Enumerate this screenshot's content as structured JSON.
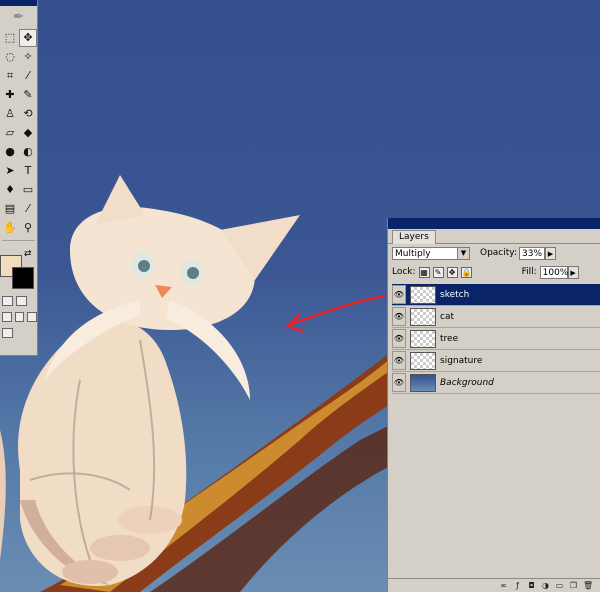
{
  "colors": {
    "canvas_top": "#34508f",
    "canvas_bottom": "#6a8db3",
    "panel_bg": "#d4d0c8",
    "selection_blue": "#0a246a",
    "annotation_red": "#e8202a",
    "foreground_swatch": "#f2dcc0",
    "background_swatch": "#000000"
  },
  "tools_panel": {
    "logo_icon": "feather-icon",
    "rows": [
      [
        "marquee-icon",
        "move-icon"
      ],
      [
        "lasso-icon",
        "magic-wand-icon"
      ],
      [
        "crop-icon",
        "slice-icon"
      ],
      [
        "healing-brush-icon",
        "brush-icon"
      ],
      [
        "clone-stamp-icon",
        "history-brush-icon"
      ],
      [
        "eraser-icon",
        "paint-bucket-icon"
      ],
      [
        "blur-icon",
        "dodge-icon"
      ],
      [
        "path-select-icon",
        "type-icon"
      ],
      [
        "pen-icon",
        "rectangle-shape-icon"
      ],
      [
        "notes-icon",
        "eyedropper-icon"
      ],
      [
        "hand-icon",
        "zoom-icon"
      ]
    ],
    "glyphs": {
      "feather-icon": "✒",
      "marquee-icon": "⬚",
      "move-icon": "✥",
      "lasso-icon": "◌",
      "magic-wand-icon": "✧",
      "crop-icon": "⌗",
      "slice-icon": "⁄",
      "healing-brush-icon": "✚",
      "brush-icon": "✎",
      "clone-stamp-icon": "♙",
      "history-brush-icon": "⟲",
      "eraser-icon": "▱",
      "paint-bucket-icon": "◆",
      "blur-icon": "●",
      "dodge-icon": "◐",
      "path-select-icon": "➤",
      "type-icon": "T",
      "pen-icon": "♦",
      "rectangle-shape-icon": "▭",
      "notes-icon": "▤",
      "eyedropper-icon": "⁄",
      "hand-icon": "✋",
      "zoom-icon": "⚲"
    }
  },
  "layers_panel": {
    "tab_label": "Layers",
    "blend_mode": "Multiply",
    "opacity_label": "Opacity:",
    "opacity_value": "33%",
    "lock_label": "Lock:",
    "fill_label": "Fill:",
    "fill_value": "100%",
    "layers": [
      {
        "name": "sketch",
        "active": true,
        "italic": false,
        "thumb": "transparent"
      },
      {
        "name": "cat",
        "active": false,
        "italic": false,
        "thumb": "transparent"
      },
      {
        "name": "tree",
        "active": false,
        "italic": false,
        "thumb": "transparent"
      },
      {
        "name": "signature",
        "active": false,
        "italic": false,
        "thumb": "transparent"
      },
      {
        "name": "Background",
        "active": false,
        "italic": true,
        "thumb": "background"
      }
    ],
    "footer_icons": [
      "link-icon",
      "layer-style-icon",
      "mask-icon",
      "adjustment-icon",
      "new-group-icon",
      "new-layer-icon",
      "trash-icon"
    ]
  }
}
